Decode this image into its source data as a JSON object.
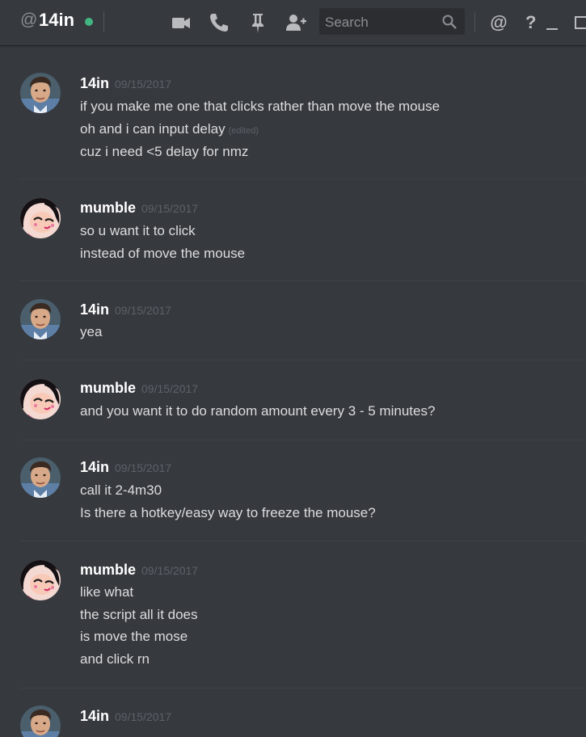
{
  "header": {
    "at_symbol": "@",
    "dm_name": "14in",
    "status_color": "#43b581",
    "icons": [
      "video-call-icon",
      "phone-call-icon",
      "pin-icon",
      "add-friend-icon",
      "search-icon",
      "mention-icon",
      "help-icon",
      "minimize-icon",
      "maximize-icon"
    ],
    "search_placeholder": "Search",
    "mention_label": "@",
    "help_label": "?"
  },
  "messages": [
    {
      "author": "14in",
      "timestamp": "09/15/2017",
      "avatar": "photo",
      "lines": [
        "if you make me one that clicks rather than move the mouse",
        "oh and i can input delay",
        "cuz i need <5 delay for nmz"
      ],
      "edited_label": "(edited)"
    },
    {
      "author": "mumble",
      "timestamp": "09/15/2017",
      "avatar": "anime",
      "lines": [
        "so u want it to click",
        "instead of move the mouse"
      ]
    },
    {
      "author": "14in",
      "timestamp": "09/15/2017",
      "avatar": "photo",
      "lines": [
        "yea"
      ]
    },
    {
      "author": "mumble",
      "timestamp": "09/15/2017",
      "avatar": "anime",
      "lines": [
        "and you want it to do random amount every 3 - 5 minutes?"
      ]
    },
    {
      "author": "14in",
      "timestamp": "09/15/2017",
      "avatar": "photo",
      "lines": [
        "call it 2-4m30",
        "Is there a hotkey/easy way to freeze the mouse?"
      ]
    },
    {
      "author": "mumble",
      "timestamp": "09/15/2017",
      "avatar": "anime",
      "lines": [
        "like what",
        "the script all it does",
        "is move the mose",
        "and click rn"
      ]
    },
    {
      "author": "14in",
      "timestamp": "09/15/2017",
      "avatar": "photo",
      "lines": []
    }
  ]
}
